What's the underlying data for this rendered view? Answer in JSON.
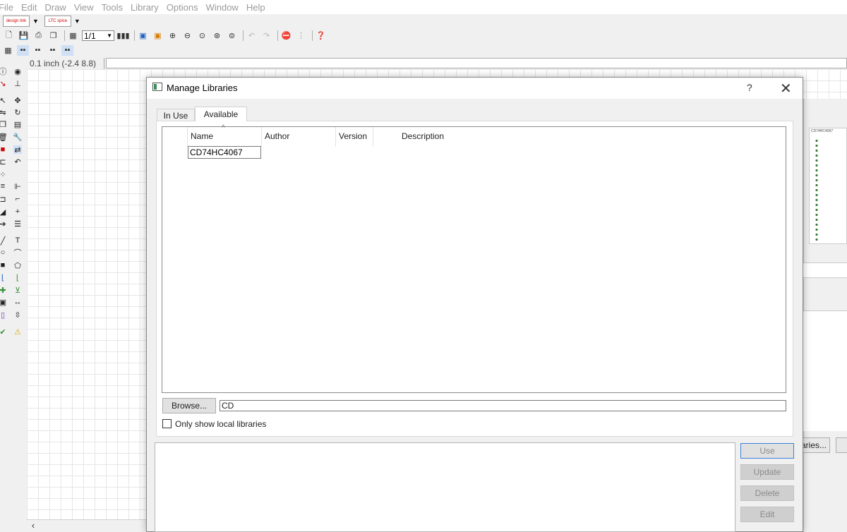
{
  "menu": [
    "File",
    "Edit",
    "Draw",
    "View",
    "Tools",
    "Library",
    "Options",
    "Window",
    "Help"
  ],
  "toolbar": {
    "page_select": "1/1",
    "logo1": "design link",
    "logo2": "LTC spice"
  },
  "coords": {
    "readout": "0.1 inch (-2.4 8.8)"
  },
  "background_dialog": {
    "preview_title": "CD74HC4067",
    "libraries_button": "aries..."
  },
  "dialog": {
    "title": "Manage Libraries",
    "help": "?",
    "close": "✕",
    "tabs": [
      {
        "label": "In Use",
        "active": false
      },
      {
        "label": "Available",
        "active": true
      }
    ],
    "columns": [
      "Name",
      "Author",
      "Version",
      "Description"
    ],
    "sort_indicator": "^",
    "rows": [
      {
        "name": "CD74HC4067",
        "author": "",
        "version": "",
        "description": ""
      }
    ],
    "browse_label": "Browse...",
    "filter_value": "CD",
    "local_only_label": "Only show local libraries",
    "local_only_checked": false,
    "buttons": {
      "use": "Use",
      "update": "Update",
      "delete": "Delete",
      "edit": "Edit"
    }
  },
  "colors": {
    "accent": "#3c82d6",
    "preview_pins": "#3a7a3a"
  }
}
